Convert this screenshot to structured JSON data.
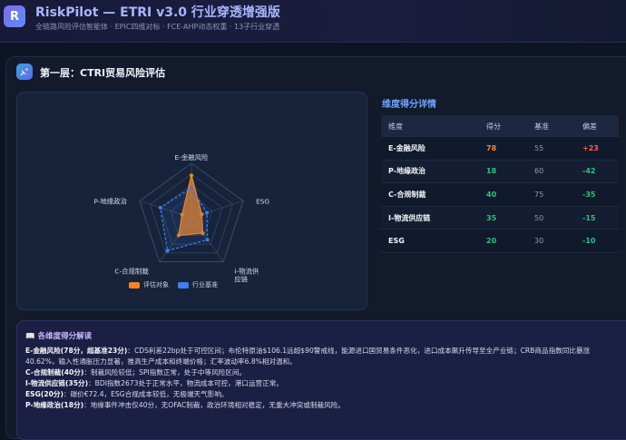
{
  "app": {
    "logo_letter": "R",
    "title": "RiskPilot — ETRI v3.0 行业穿透增强版",
    "subtitle": "全链路风险评估智能体 · EPIC四维对标 · FCE-AHP动态权重 · 13子行业穿透"
  },
  "section": {
    "icon": "satellite-icon",
    "title": "第一层：CTRI贸易风险评估"
  },
  "chart_data": {
    "type": "radar",
    "axes": [
      "E-金融风险",
      "ESG",
      "I-物流供应链",
      "C-合规制裁",
      "P-地缘政治"
    ],
    "rmax": 100,
    "series": [
      {
        "name": "评估对象",
        "color": "#f5861f",
        "values": [
          78,
          20,
          35,
          40,
          18
        ]
      },
      {
        "name": "行业基准",
        "color": "#3b7ff0",
        "values": [
          55,
          30,
          50,
          75,
          60
        ]
      }
    ],
    "legend_position": "bottom"
  },
  "detail": {
    "title": "维度得分详情",
    "headers": [
      "维度",
      "得分",
      "基准",
      "偏差"
    ],
    "rows": [
      {
        "dim": "E-金融风险",
        "score": "78",
        "std": "55",
        "dev": "+23",
        "score_color": "#f5861f",
        "dev_color": "#ff5a5a"
      },
      {
        "dim": "P-地缘政治",
        "score": "18",
        "std": "60",
        "dev": "-42",
        "score_color": "#2ec27e",
        "dev_color": "#2ec27e"
      },
      {
        "dim": "C-合规制裁",
        "score": "40",
        "std": "75",
        "dev": "-35",
        "score_color": "#2ec27e",
        "dev_color": "#2ec27e"
      },
      {
        "dim": "I-物流供应链",
        "score": "35",
        "std": "50",
        "dev": "-15",
        "score_color": "#2ec27e",
        "dev_color": "#2ec27e"
      },
      {
        "dim": "ESG",
        "score": "20",
        "std": "30",
        "dev": "-10",
        "score_color": "#2ec27e",
        "dev_color": "#2ec27e"
      }
    ]
  },
  "interpretation": {
    "icon": "book-icon",
    "title": "各维度得分解读",
    "items": [
      {
        "head": "E-金融风险(78分，超基准23分)",
        "body": "：CDS利差22bp处于可控区间；布伦特原油$106.1远超$90警戒线，能源进口国贸易条件恶化，进口成本飙升传导至全产业链；CRB商品指数同比暴涨40.62%，输入性通胀压力显著，推高生产成本和终端价格；汇率波动率6.8%相对温和。"
      },
      {
        "head": "C-合规制裁(40分)",
        "body": "：制裁风险较低；SPI指数正常，处于中等风险区间。"
      },
      {
        "head": "I-物流供应链(35分)",
        "body": "：BDI指数2673处于正常水平，物流成本可控，港口运营正常。"
      },
      {
        "head": "ESG(20分)",
        "body": "：碳价€72.4，ESG合规成本较低，无极端天气影响。"
      },
      {
        "head": "P-地缘政治(18分)",
        "body": "：地缘事件冲击仅40分，无OFAC制裁，政治环境相对稳定，无重大冲突或制裁风险。"
      }
    ]
  }
}
